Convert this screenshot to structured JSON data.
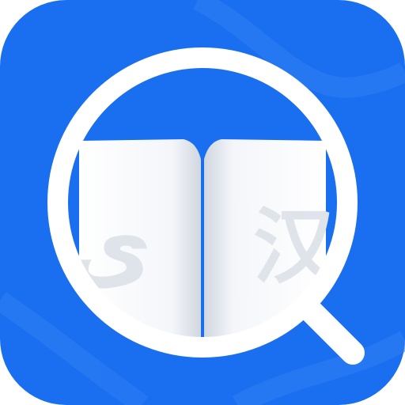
{
  "icon": {
    "name": "dictionary-search-app-icon",
    "background_color": "#1a6ff0",
    "ring_color": "#ffffff",
    "page_color": "#ffffff",
    "left_glyph": "ى",
    "right_glyph": "汉",
    "glyph_color": "#dfe3ea"
  }
}
